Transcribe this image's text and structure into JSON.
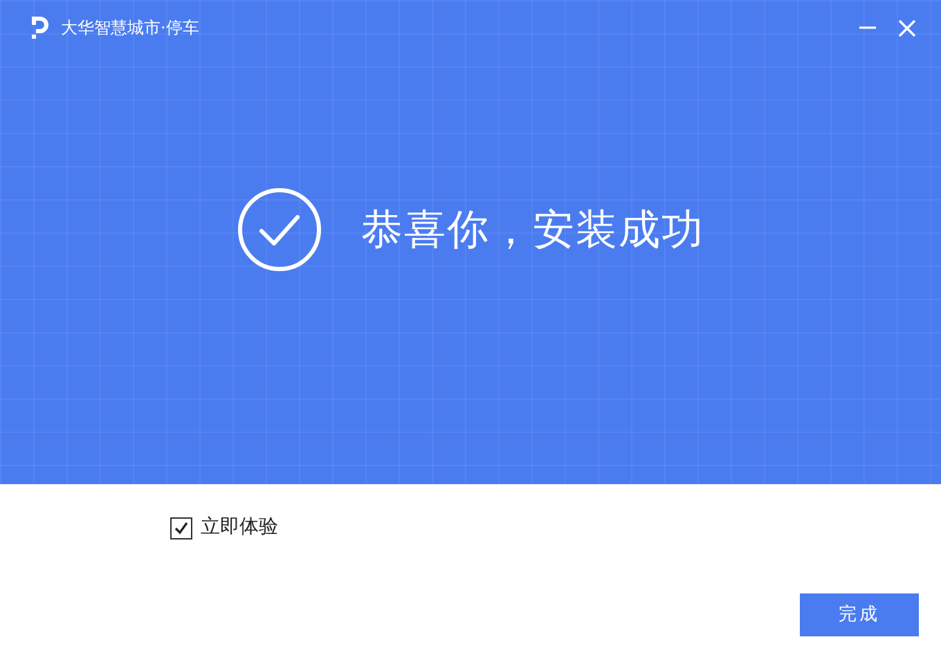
{
  "window": {
    "title": "大华智慧城市·停车"
  },
  "banner": {
    "message": "恭喜你，安装成功"
  },
  "launch_option": {
    "label": "立即体验",
    "checked": true
  },
  "buttons": [
    "完成"
  ]
}
